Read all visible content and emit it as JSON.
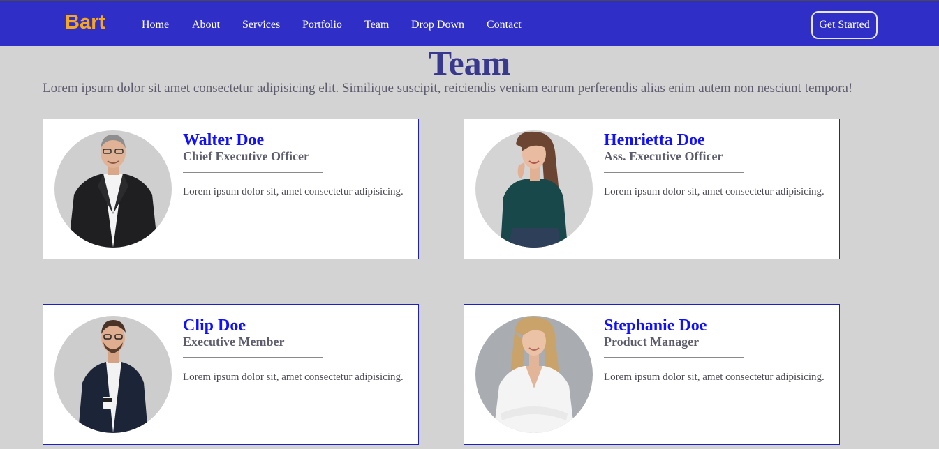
{
  "brand": {
    "name": "Bart",
    "color": "#f5a623"
  },
  "nav": {
    "items": [
      {
        "label": "Home"
      },
      {
        "label": "About"
      },
      {
        "label": "Services"
      },
      {
        "label": "Portfolio"
      },
      {
        "label": "Team"
      },
      {
        "label": "Drop Down"
      },
      {
        "label": "Contact"
      }
    ],
    "cta_label": "Get Started",
    "background": "#2f2fc8"
  },
  "section": {
    "title": "Team",
    "subtitle": "Lorem ipsum dolor sit amet consectetur adipisicing elit. Similique suscipit, reiciendis veniam earum perferendis alias enim autem non nesciunt tempora!"
  },
  "team": [
    {
      "name": "Walter Doe",
      "role": "Chief Executive Officer",
      "description": "Lorem ipsum dolor sit, amet consectetur adipisicing."
    },
    {
      "name": "Henrietta Doe",
      "role": "Ass. Executive Officer",
      "description": "Lorem ipsum dolor sit, amet consectetur adipisicing."
    },
    {
      "name": "Clip Doe",
      "role": "Executive Member",
      "description": "Lorem ipsum dolor sit, amet consectetur adipisicing."
    },
    {
      "name": "Stephanie Doe",
      "role": "Product Manager",
      "description": "Lorem ipsum dolor sit, amet consectetur adipisicing."
    }
  ],
  "colors": {
    "accent": "#1010ff",
    "title": "#38388f",
    "page_background": "#d3d3d3"
  }
}
